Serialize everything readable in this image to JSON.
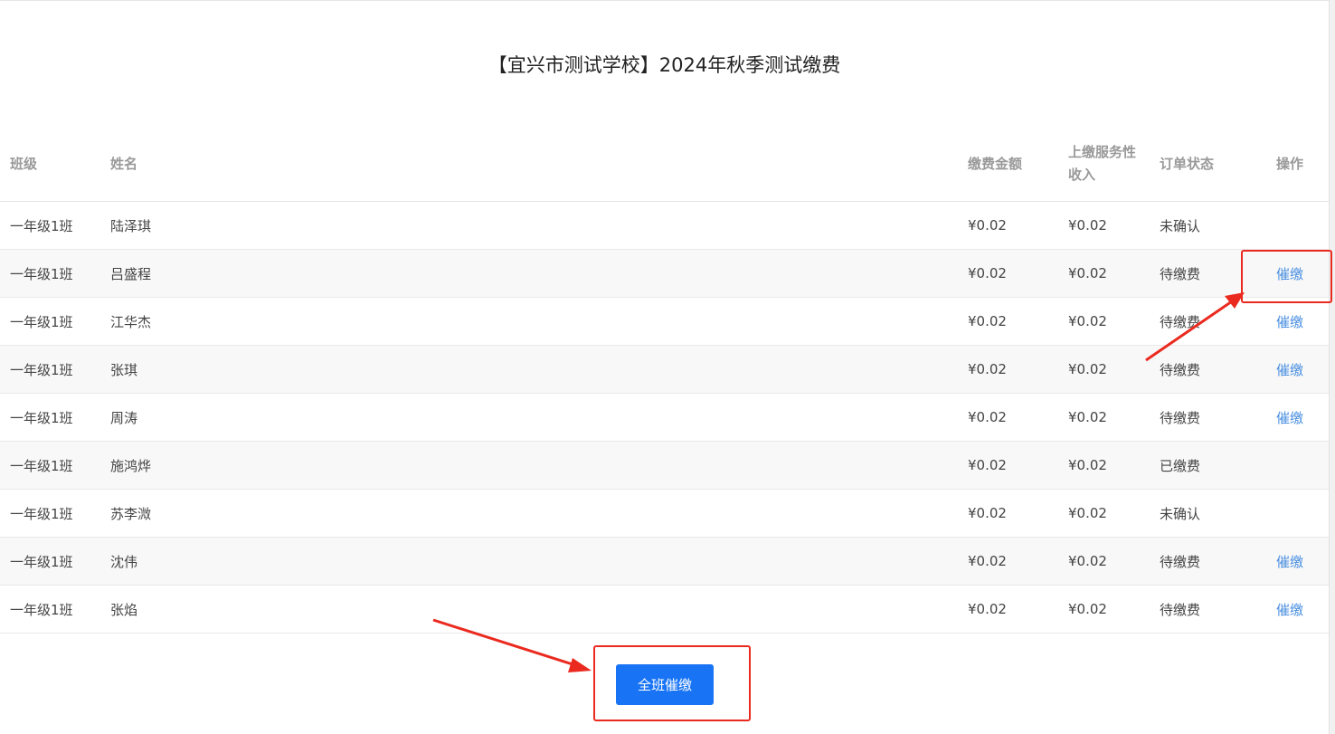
{
  "page": {
    "title": "【宜兴市测试学校】2024年秋季测试缴费"
  },
  "table": {
    "headers": {
      "class": "班级",
      "name": "姓名",
      "amount": "缴费金额",
      "service": "上缴服务性收入",
      "status": "订单状态",
      "action": "操作"
    },
    "rows": [
      {
        "class": "一年级1班",
        "name": "陆泽琪",
        "amount": "¥0.02",
        "service": "¥0.02",
        "status": "未确认",
        "action": ""
      },
      {
        "class": "一年级1班",
        "name": "吕盛程",
        "amount": "¥0.02",
        "service": "¥0.02",
        "status": "待缴费",
        "action": "催缴"
      },
      {
        "class": "一年级1班",
        "name": "江华杰",
        "amount": "¥0.02",
        "service": "¥0.02",
        "status": "待缴费",
        "action": "催缴"
      },
      {
        "class": "一年级1班",
        "name": "张琪",
        "amount": "¥0.02",
        "service": "¥0.02",
        "status": "待缴费",
        "action": "催缴"
      },
      {
        "class": "一年级1班",
        "name": "周涛",
        "amount": "¥0.02",
        "service": "¥0.02",
        "status": "待缴费",
        "action": "催缴"
      },
      {
        "class": "一年级1班",
        "name": "施鸿烨",
        "amount": "¥0.02",
        "service": "¥0.02",
        "status": "已缴费",
        "action": ""
      },
      {
        "class": "一年级1班",
        "name": "苏李溦",
        "amount": "¥0.02",
        "service": "¥0.02",
        "status": "未确认",
        "action": ""
      },
      {
        "class": "一年级1班",
        "name": "沈伟",
        "amount": "¥0.02",
        "service": "¥0.02",
        "status": "待缴费",
        "action": "催缴"
      },
      {
        "class": "一年级1班",
        "name": "张焰",
        "amount": "¥0.02",
        "service": "¥0.02",
        "status": "待缴费",
        "action": "催缴"
      }
    ]
  },
  "footer": {
    "remind_all_label": "全班催缴"
  },
  "colors": {
    "primary_button": "#1874f5",
    "link": "#4a8fe0",
    "annotation": "#ea2a1f"
  }
}
